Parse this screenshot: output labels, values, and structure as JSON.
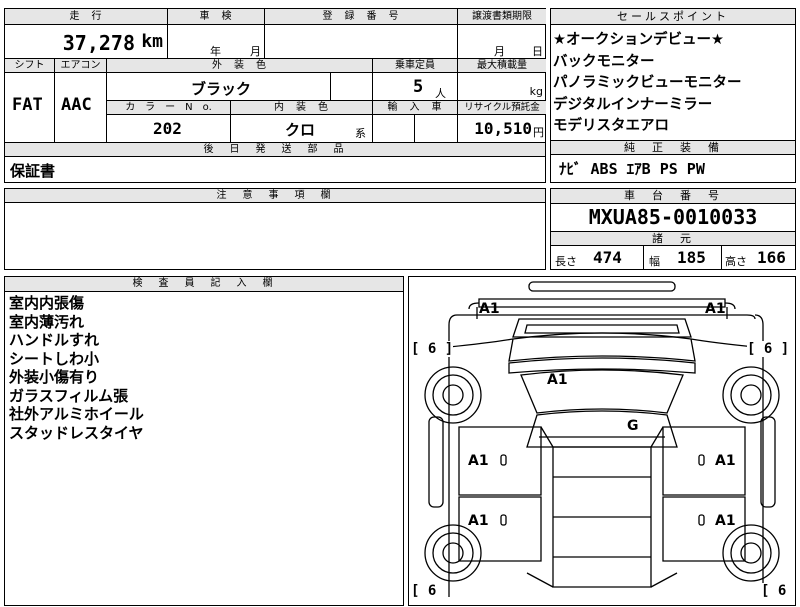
{
  "top": {
    "mileage_label": "走　行",
    "inspection_label": "車　検",
    "registration_label": "登　録　番　号",
    "transfer_label": "譲渡書類期限",
    "mileage_value": "37,278",
    "mileage_unit": "km",
    "insp_year": "年",
    "insp_month": "月",
    "transfer_month": "月",
    "transfer_day": "日"
  },
  "mid": {
    "shift_label": "シフト",
    "ac_label": "エアコン",
    "ext_color_label": "外　装　色",
    "capacity_label": "乗車定員",
    "max_load_label": "最大積載量",
    "shift_value": "FAT",
    "ac_value": "AAC",
    "ext_color_value": "ブラック",
    "capacity_value": "5",
    "capacity_unit": "人",
    "load_unit": "kg",
    "colorno_label": "カ　ラ　ー　N　o.",
    "int_color_label": "内　装　色",
    "import_label": "輸　入　車",
    "recycle_label": "リサイクル預託金",
    "colorno_value": "202",
    "int_color_value": "クロ",
    "int_color_suffix": "系",
    "recycle_value": "10,510",
    "recycle_unit": "円"
  },
  "later_parts": {
    "label": "後　日　発　送　部　品",
    "value": "保証書"
  },
  "notes": {
    "label": "注　意　事　項　欄"
  },
  "sales": {
    "label": "セールスポイント",
    "items": [
      "★オークションデビュー★",
      "バックモニター",
      "パノラミックビューモニター",
      "デジタルインナーミラー",
      "モデリスタエアロ"
    ]
  },
  "equipment": {
    "label": "純　正　装　備",
    "value": "ﾅﾋﾞ ABS ｴｱB PS PW"
  },
  "chassis": {
    "label": "車　台　番　号",
    "value": "MXUA85-0010033"
  },
  "dims": {
    "label": "諸　元",
    "length_label": "長さ",
    "length_value": "474",
    "width_label": "幅",
    "width_value": "185",
    "height_label": "高さ",
    "height_value": "166"
  },
  "inspector": {
    "label": "検　査　員　記　入　欄",
    "lines": [
      "室内内張傷",
      "室内薄汚れ",
      "ハンドルすれ",
      "シートしわ小",
      "外装小傷有り",
      "ガラスフィルム張",
      "社外アルミホイール",
      "スタッドレスタイヤ"
    ]
  },
  "diagram": {
    "marks": {
      "front_left": "A1",
      "front_right": "A1",
      "hood": "A1",
      "glass": "G",
      "door_fl": "A1",
      "door_fr": "A1",
      "door_rl": "A1",
      "door_rr": "A1"
    },
    "tires": {
      "fl": "[ 6 ]",
      "fr": "[ 6 ]",
      "rl": "[ 6",
      "rr": "[ 6"
    }
  }
}
